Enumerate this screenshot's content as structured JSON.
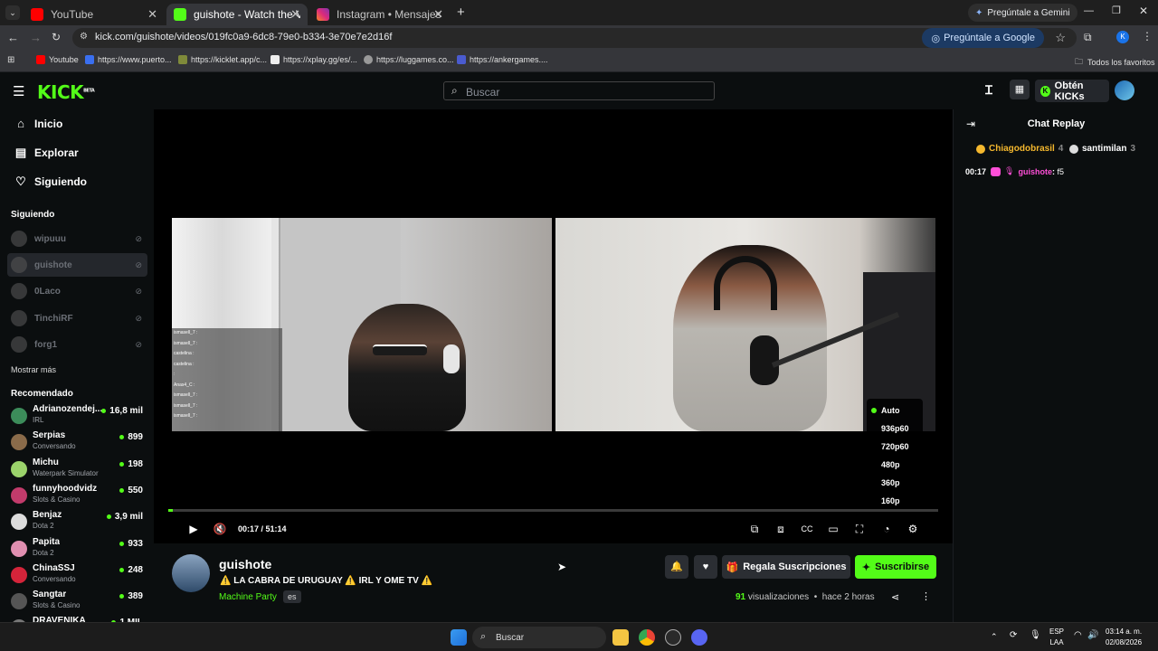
{
  "browser": {
    "tabs": [
      {
        "title": "YouTube",
        "color": "#ff0000"
      },
      {
        "title": "guishote - Watch the VOD on K",
        "color": "#53fc18"
      },
      {
        "title": "Instagram • Mensajes",
        "color": "#dd2a7b"
      }
    ],
    "gemini_tab_button": "Pregúntale a Gemini",
    "url": "kick.com/guishote/videos/019fc0a9-6dc8-79e0-b334-3e70e7e2d16f",
    "ask_google": "Pregúntale a Google",
    "bookmarks": [
      "Youtube",
      "https://www.puerto...",
      "https://kicklet.app/c...",
      "https://xplay.gg/es/...",
      "https://luggames.co...",
      "https://ankergames...."
    ],
    "all_favorites": "Todos los favoritos"
  },
  "header": {
    "logo": "KICK",
    "logo_badge": "BETA",
    "search_placeholder": "Buscar",
    "kicks_button": "Obtén KICKs"
  },
  "sidebar": {
    "nav": [
      "Inicio",
      "Explorar",
      "Siguiendo"
    ],
    "following_title": "Siguiendo",
    "following": [
      "wipuuu",
      "guishote",
      "0Laco",
      "TinchiRF",
      "forg1"
    ],
    "show_more": "Mostrar más",
    "recommended_title": "Recomendado",
    "recommended": [
      {
        "name": "Adrianozendej...",
        "category": "IRL",
        "viewers": "16,8 mil",
        "color": "#3c8c5a"
      },
      {
        "name": "Serpias",
        "category": "Conversando",
        "viewers": "899",
        "color": "#8a6b4a"
      },
      {
        "name": "Michu",
        "category": "Waterpark Simulator",
        "viewers": "198",
        "color": "#9bd36b"
      },
      {
        "name": "funnyhoodvidz",
        "category": "Slots & Casino",
        "viewers": "550",
        "color": "#c23b6b"
      },
      {
        "name": "Benjaz",
        "category": "Dota 2",
        "viewers": "3,9 mil",
        "color": "#dcdcdc"
      },
      {
        "name": "Papita",
        "category": "Dota 2",
        "viewers": "933",
        "color": "#e08fb0"
      },
      {
        "name": "ChinaSSJ",
        "category": "Conversando",
        "viewers": "248",
        "color": "#d4243a"
      },
      {
        "name": "Sangtar",
        "category": "Slots & Casino",
        "viewers": "389",
        "color": "#555555"
      },
      {
        "name": "DRAVENIKA",
        "category": "",
        "viewers": "1 MIL",
        "color": "#777777"
      }
    ]
  },
  "player": {
    "progress": 0.0055,
    "time_current": "00:17",
    "time_total": "51:14",
    "qualities": [
      "Auto",
      "936p60",
      "720p60",
      "480p",
      "360p",
      "160p"
    ],
    "selected_quality": "Auto",
    "overlay_chat": [
      "ismasell_7 :",
      "ismasell_7 :",
      "castelina :",
      "castelina :",
      ":",
      "Anas4_C :",
      "ismasell_7 :",
      "ismasell_7 :",
      "ismasell_7 :"
    ]
  },
  "channel": {
    "name": "guishote",
    "title": "⚠️ LA CABRA DE URUGUAY ⚠️ IRL Y OME TV ⚠️",
    "category": "Machine Party",
    "language": "es",
    "gift_button": "Regala Suscripciones",
    "subscribe_button": "Suscribirse",
    "views": "91",
    "views_label": "visualizaciones",
    "when": "hace 2 horas"
  },
  "chat": {
    "title": "Chat Replay",
    "gifters": [
      {
        "name": "Chiagodobrasil",
        "count": "4",
        "color": "#f5b82e"
      },
      {
        "name": "santimilan",
        "count": "3",
        "color": "#ffffff"
      }
    ],
    "message": {
      "time": "00:17",
      "user": "guishote",
      "text": "f5",
      "user_color": "#ff4fd8"
    }
  },
  "taskbar": {
    "search": "Buscar",
    "lang_top": "ESP",
    "lang_bottom": "LAA",
    "time": "03:14 a. m.",
    "date": "02/08/2026"
  }
}
